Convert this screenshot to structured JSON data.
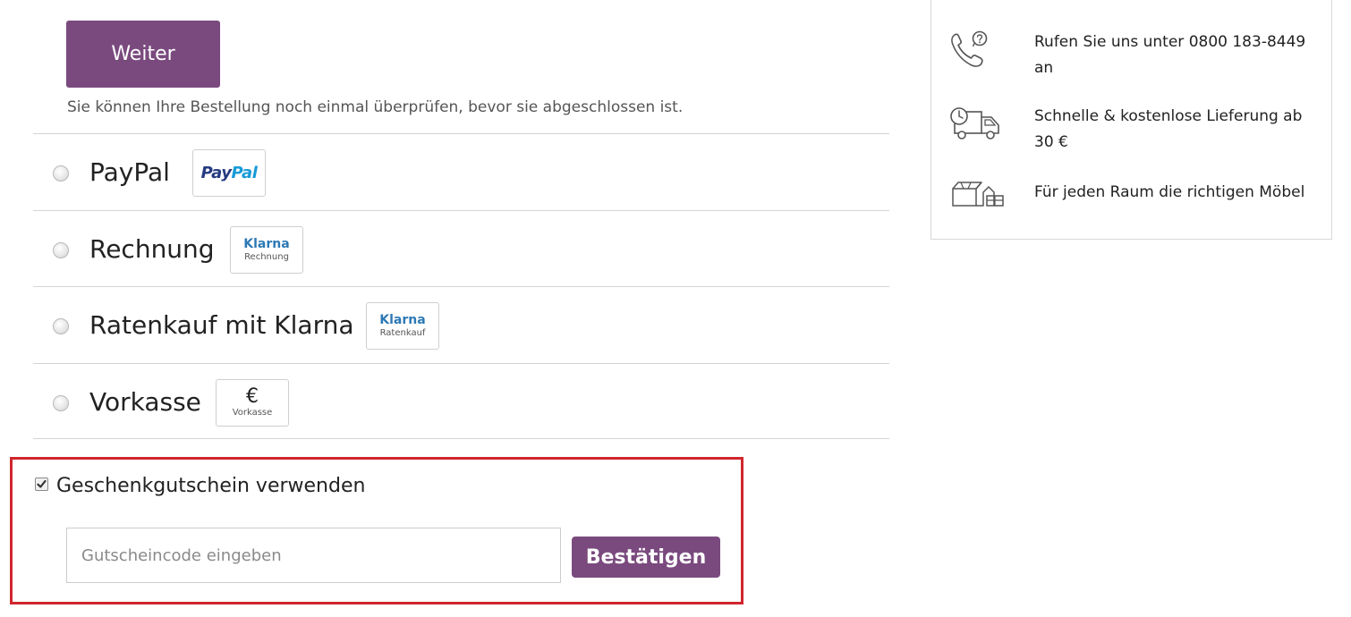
{
  "checkout": {
    "continue_label": "Weiter",
    "review_note": "Sie können Ihre Bestellung noch einmal überprüfen, bevor sie abgeschlossen ist."
  },
  "payment_methods": [
    {
      "label": "PayPal",
      "logo": {
        "text_1": "Pay",
        "text_2": "Pal"
      }
    },
    {
      "label": "Rechnung",
      "logo": {
        "brand": "Klarna",
        "sub": "Rechnung"
      }
    },
    {
      "label": "Ratenkauf mit Klarna",
      "logo": {
        "brand": "Klarna",
        "sub": "Ratenkauf"
      }
    },
    {
      "label": "Vorkasse",
      "logo": {
        "symbol": "€",
        "sub": "Vorkasse"
      }
    }
  ],
  "voucher": {
    "checked": true,
    "label": "Geschenkgutschein verwenden",
    "placeholder": "Gutscheincode eingeben",
    "confirm_label": "Bestätigen"
  },
  "info": {
    "items": [
      {
        "icon": "phone-question-icon",
        "text": "Rufen Sie uns unter 0800 183-8449 an"
      },
      {
        "icon": "delivery-truck-icon",
        "text": "Schnelle & kostenlose Lieferung ab 30 €"
      },
      {
        "icon": "furniture-box-icon",
        "text": "Für jeden Raum die richtigen Möbel"
      }
    ]
  },
  "colors": {
    "primary_button": "#7a4a7e",
    "highlight_border": "#d0262e",
    "paypal_dark": "#253b80",
    "paypal_light": "#179bd7",
    "klarna_blue": "#2d79b5"
  }
}
